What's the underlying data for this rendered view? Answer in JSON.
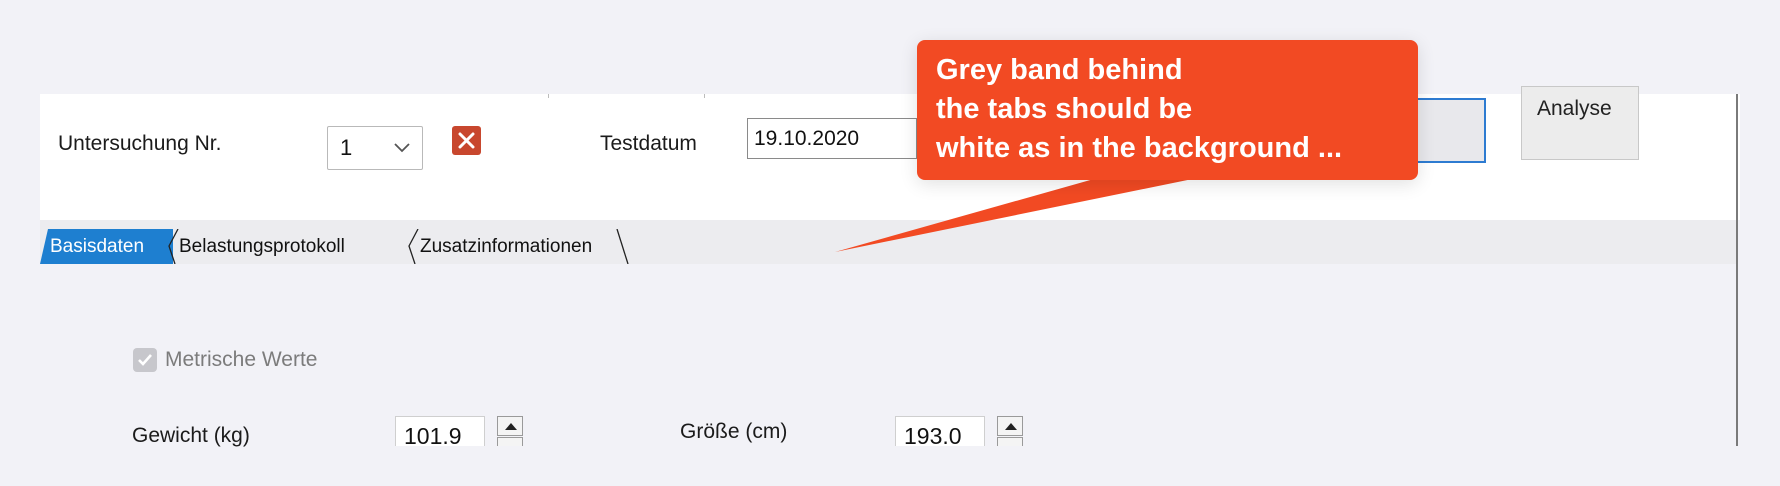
{
  "form": {
    "exam_label": "Untersuchung Nr.",
    "exam_value": "1",
    "date_label": "Testdatum",
    "date_value": "19.10.2020",
    "analyse_label": "Analyse"
  },
  "tabs": [
    {
      "label": "Basisdaten",
      "active": true
    },
    {
      "label": "Belastungsprotokoll",
      "active": false
    },
    {
      "label": "Zusatzinformationen",
      "active": false
    }
  ],
  "basis": {
    "metric_label": "Metrische Werte",
    "metric_checked": true,
    "weight_label": "Gewicht (kg)",
    "weight_value": "101.9",
    "height_label": "Größe (cm)",
    "height_value": "193.0"
  },
  "annotation": {
    "lines": [
      "Grey band behind",
      "the tabs should be",
      "white as in the background ..."
    ]
  },
  "colors": {
    "accent_tab": "#1e7fd0",
    "callout": "#f24a23",
    "delete": "#c8472e",
    "focus_border": "#2d7bd1"
  }
}
